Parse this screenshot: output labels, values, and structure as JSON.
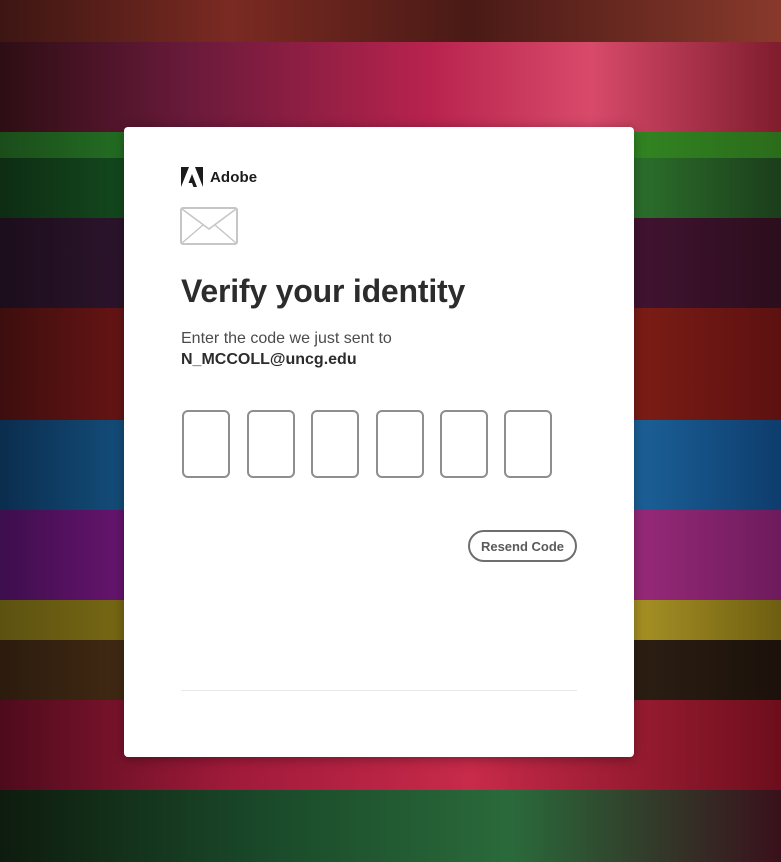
{
  "brand": {
    "name": "Adobe",
    "logo_icon": "adobe-logo-icon"
  },
  "verify": {
    "envelope_icon": "envelope-icon",
    "title": "Verify your identity",
    "instruction": "Enter the code we just sent to",
    "email": "N_MCCOLL@uncg.edu"
  },
  "code_inputs": [
    {
      "value": ""
    },
    {
      "value": ""
    },
    {
      "value": ""
    },
    {
      "value": ""
    },
    {
      "value": ""
    },
    {
      "value": ""
    }
  ],
  "actions": {
    "resend_label": "Resend Code"
  },
  "colors": {
    "card_background": "#ffffff",
    "title_text": "#2c2c2c",
    "input_border": "#8e8e8e",
    "button_border": "#6e6e6e"
  }
}
